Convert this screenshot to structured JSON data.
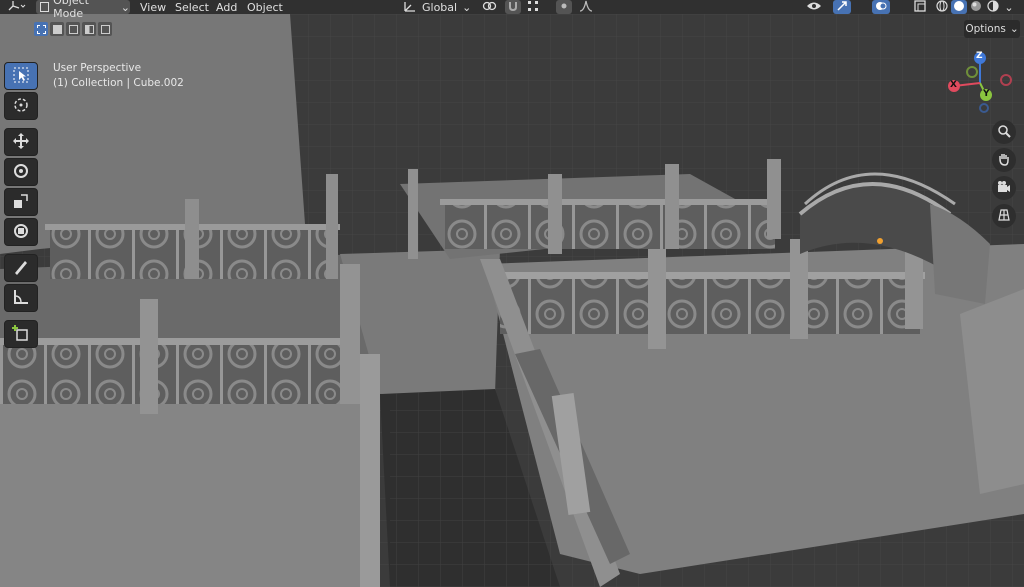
{
  "header": {
    "mode_label": "Object Mode",
    "menus": [
      "View",
      "Select",
      "Add",
      "Object"
    ],
    "orientation": "Global",
    "options_label": "Options"
  },
  "overlay": {
    "view_name": "User Perspective",
    "collection_info": "(1) Collection | Cube.002"
  },
  "gizmo": {
    "z": "Z",
    "y": "Y",
    "x": "X"
  },
  "colors": {
    "accent": "#4772b3",
    "axis_x": "#e04a5e",
    "axis_y": "#8bc53f",
    "axis_z": "#3f78d8"
  },
  "icons": {
    "editor_type": "axis-icon",
    "tools": [
      "select-box-icon",
      "cursor-icon",
      "move-icon",
      "rotate-icon",
      "scale-icon",
      "transform-icon",
      "annotate-icon",
      "measure-icon",
      "add-cube-icon"
    ],
    "nav": [
      "zoom-icon",
      "hand-pan-icon",
      "camera-icon",
      "grid-view-icon"
    ]
  }
}
